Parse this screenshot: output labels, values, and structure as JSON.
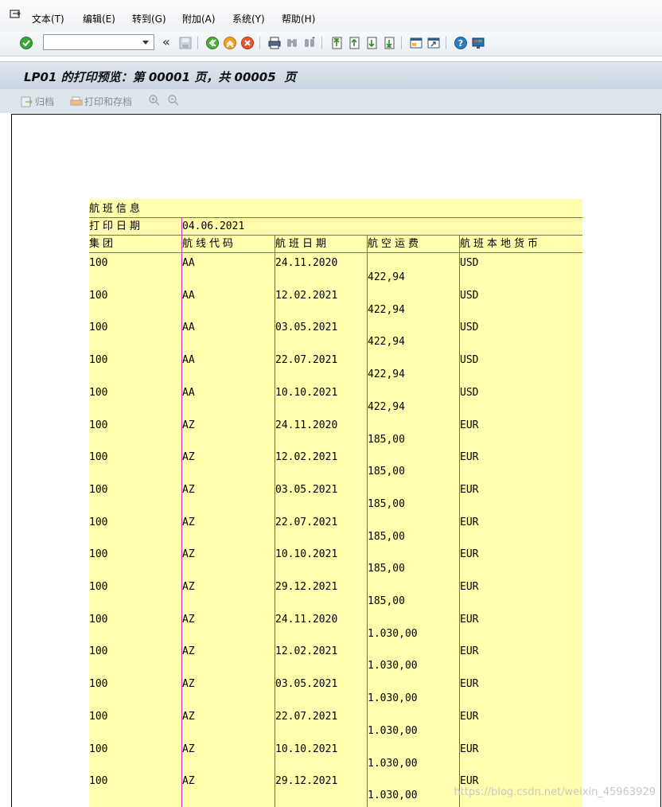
{
  "menu": {
    "items": [
      "文本(T)",
      "编辑(E)",
      "转到(G)",
      "附加(A)",
      "系统(Y)",
      "帮助(H)"
    ]
  },
  "toolbar": {
    "command_field_value": "",
    "icons": [
      "enter-icon",
      "save-icon",
      "back-icon",
      "exit-icon",
      "cancel-icon",
      "print-icon",
      "find-icon",
      "find-next-icon",
      "first-page-icon",
      "previous-page-icon",
      "next-page-icon",
      "last-page-icon",
      "new-session-icon",
      "shortcut-icon",
      "help-icon",
      "customize-layout-icon"
    ]
  },
  "title": "LP01 的打印预览：第 00001 页，共 00005  页",
  "app_toolbar": {
    "archive_label": "归档",
    "print_archive_label": "打印和存档"
  },
  "report": {
    "header_title": "航班信息",
    "print_date_label": "打印日期",
    "print_date_value": "04.06.2021",
    "columns": [
      "集团",
      "航线代码",
      "航班日期",
      "航空运费",
      "航班本地货币"
    ],
    "rows": [
      {
        "group": "100",
        "route": "AA",
        "date": "24.11.2020",
        "fare": "422,94",
        "currency": "USD"
      },
      {
        "group": "100",
        "route": "AA",
        "date": "12.02.2021",
        "fare": "422,94",
        "currency": "USD"
      },
      {
        "group": "100",
        "route": "AA",
        "date": "03.05.2021",
        "fare": "422,94",
        "currency": "USD"
      },
      {
        "group": "100",
        "route": "AA",
        "date": "22.07.2021",
        "fare": "422,94",
        "currency": "USD"
      },
      {
        "group": "100",
        "route": "AA",
        "date": "10.10.2021",
        "fare": "422,94",
        "currency": "USD"
      },
      {
        "group": "100",
        "route": "AZ",
        "date": "24.11.2020",
        "fare": "185,00",
        "currency": "EUR"
      },
      {
        "group": "100",
        "route": "AZ",
        "date": "12.02.2021",
        "fare": "185,00",
        "currency": "EUR"
      },
      {
        "group": "100",
        "route": "AZ",
        "date": "03.05.2021",
        "fare": "185,00",
        "currency": "EUR"
      },
      {
        "group": "100",
        "route": "AZ",
        "date": "22.07.2021",
        "fare": "185,00",
        "currency": "EUR"
      },
      {
        "group": "100",
        "route": "AZ",
        "date": "10.10.2021",
        "fare": "185,00",
        "currency": "EUR"
      },
      {
        "group": "100",
        "route": "AZ",
        "date": "29.12.2021",
        "fare": "185,00",
        "currency": "EUR"
      },
      {
        "group": "100",
        "route": "AZ",
        "date": "24.11.2020",
        "fare": "1.030,00",
        "currency": "EUR"
      },
      {
        "group": "100",
        "route": "AZ",
        "date": "12.02.2021",
        "fare": "1.030,00",
        "currency": "EUR"
      },
      {
        "group": "100",
        "route": "AZ",
        "date": "03.05.2021",
        "fare": "1.030,00",
        "currency": "EUR"
      },
      {
        "group": "100",
        "route": "AZ",
        "date": "22.07.2021",
        "fare": "1.030,00",
        "currency": "EUR"
      },
      {
        "group": "100",
        "route": "AZ",
        "date": "10.10.2021",
        "fare": "1.030,00",
        "currency": "EUR"
      },
      {
        "group": "100",
        "route": "AZ",
        "date": "29.12.2021",
        "fare": "1.030,00",
        "currency": "EUR"
      }
    ]
  },
  "watermark": "https://blog.csdn.net/weixin_45963929",
  "colors": {
    "sheet_background": "#ffffad",
    "grid_line": "#cc33cc",
    "title_bar": "#cfdbe6"
  }
}
